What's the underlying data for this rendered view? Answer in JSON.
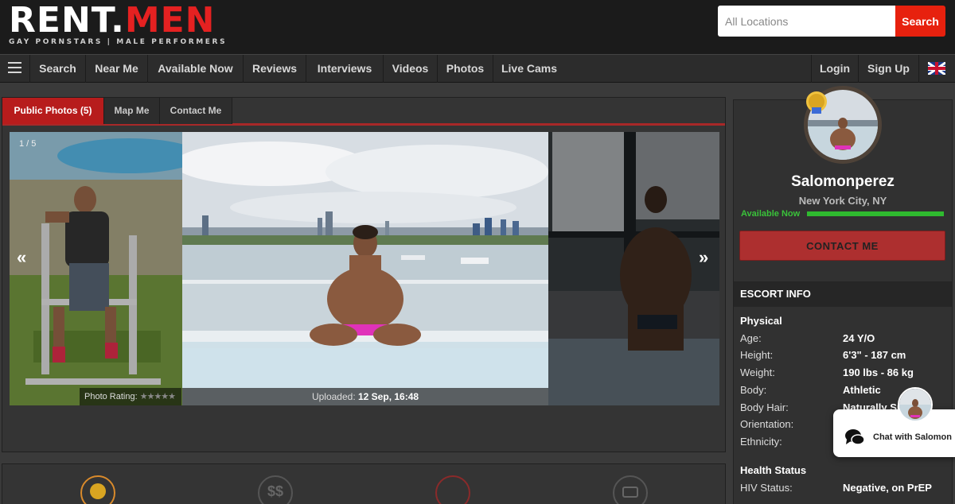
{
  "brand": {
    "name_part1": "RENT.",
    "name_part2": "MEN",
    "tagline": "GAY PORNSTARS | MALE PERFORMERS",
    "accent": "#e52121"
  },
  "search": {
    "placeholder": "All Locations",
    "button_label": "Search"
  },
  "nav": {
    "items": [
      "Search",
      "Near Me",
      "Available Now",
      "Reviews",
      "Interviews",
      "Videos",
      "Photos",
      "Live Cams"
    ],
    "login": "Login",
    "signup": "Sign Up",
    "menu_icon": "hamburger-icon",
    "flag_icon": "uk-flag-icon"
  },
  "tabs": [
    {
      "label": "Public Photos (5)",
      "active": true
    },
    {
      "label": "Map Me",
      "active": false
    },
    {
      "label": "Contact Me",
      "active": false
    }
  ],
  "gallery": {
    "counter": "1 / 5",
    "prev_icon": "«",
    "next_icon": "»",
    "rating_label": "Photo Rating:",
    "rating_stars": "★★★★★",
    "uploaded_label": "Uploaded:",
    "uploaded_value": "12 Sep, 16:48"
  },
  "profile": {
    "name": "Salomonperez",
    "location": "New York City, NY",
    "availability": "Available Now",
    "contact_label": "CONTACT ME"
  },
  "escort_info": {
    "title": "ESCORT INFO",
    "physical_title": "Physical",
    "physical": [
      {
        "label": "Age:",
        "value": "24 Y/O"
      },
      {
        "label": "Height:",
        "value": "6'3\" - 187 cm"
      },
      {
        "label": "Weight:",
        "value": "190 lbs - 86 kg"
      },
      {
        "label": "Body:",
        "value": "Athletic"
      },
      {
        "label": "Body Hair:",
        "value": "Naturally Sm"
      },
      {
        "label": "Orientation:",
        "value": ""
      },
      {
        "label": "Ethnicity:",
        "value": ""
      }
    ],
    "health_title": "Health Status",
    "health": [
      {
        "label": "HIV Status:",
        "value": "Negative, on PrEP"
      }
    ]
  },
  "chat": {
    "label": "Chat with Salomon"
  }
}
